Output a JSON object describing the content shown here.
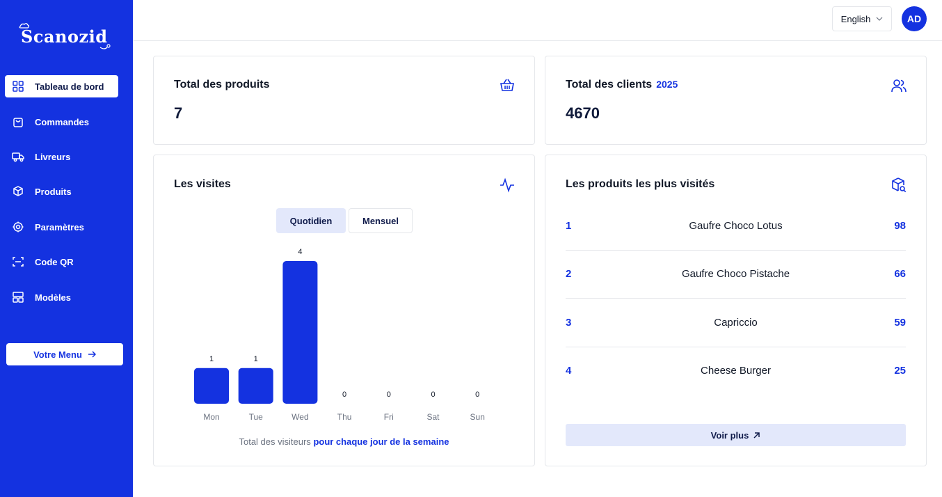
{
  "brand": {
    "name": "Scanozid"
  },
  "sidebar": {
    "items": [
      {
        "label": "Tableau de bord",
        "icon": "dashboard-grid-icon",
        "active": true
      },
      {
        "label": "Commandes",
        "icon": "shopping-bag-icon"
      },
      {
        "label": "Livreurs",
        "icon": "truck-icon"
      },
      {
        "label": "Produits",
        "icon": "package-icon"
      },
      {
        "label": "Paramètres",
        "icon": "settings-gear-icon"
      },
      {
        "label": "Code QR",
        "icon": "scan-icon"
      },
      {
        "label": "Modèles",
        "icon": "layout-template-icon"
      }
    ],
    "menu_button": "Votre Menu"
  },
  "header": {
    "language": "English",
    "avatar_initials": "AD"
  },
  "stats": {
    "products": {
      "title": "Total des produits",
      "value": "7",
      "icon": "basket-icon"
    },
    "clients": {
      "title": "Total des clients",
      "year": "2025",
      "value": "4670",
      "icon": "users-icon"
    }
  },
  "visits": {
    "title": "Les visites",
    "icon": "activity-pulse-icon",
    "toggle_daily": "Quotidien",
    "toggle_monthly": "Mensuel",
    "caption_prefix": "Total des visiteurs",
    "caption_emphasis": "pour chaque jour de la semaine"
  },
  "top_products": {
    "title": "Les produits les plus visités",
    "icon": "package-search-icon",
    "items": [
      {
        "rank": "1",
        "name": "Gaufre Choco Lotus",
        "count": "98"
      },
      {
        "rank": "2",
        "name": "Gaufre Choco Pistache",
        "count": "66"
      },
      {
        "rank": "3",
        "name": "Capriccio",
        "count": "59"
      },
      {
        "rank": "4",
        "name": "Cheese Burger",
        "count": "25"
      }
    ],
    "more_button": "Voir plus"
  },
  "colors": {
    "primary": "#1432e0",
    "muted_bg": "#e3e8fb",
    "border": "#e5e7eb"
  },
  "chart_data": {
    "type": "bar",
    "categories": [
      "Mon",
      "Tue",
      "Wed",
      "Thu",
      "Fri",
      "Sat",
      "Sun"
    ],
    "values": [
      1,
      1,
      4,
      0,
      0,
      0,
      0
    ],
    "ylim": [
      0,
      4
    ],
    "grid": false,
    "data_labels": true
  }
}
